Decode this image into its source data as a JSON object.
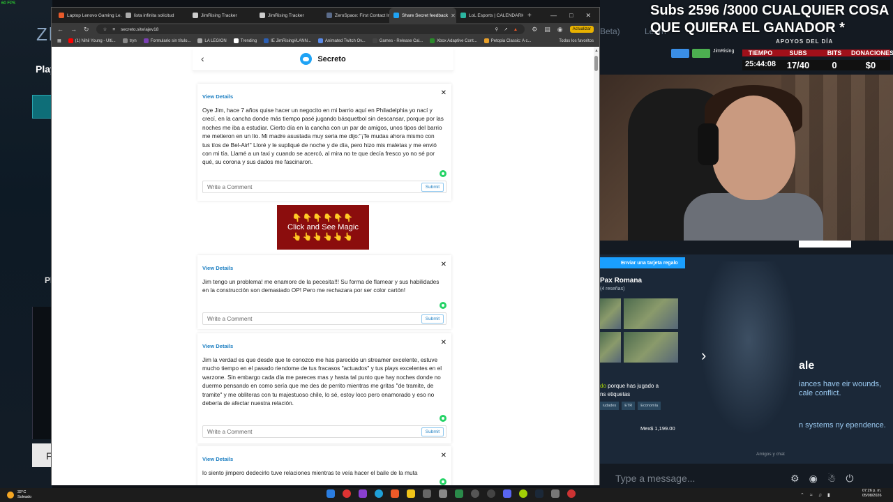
{
  "overlay": {
    "fps": "60 FPS",
    "subs_text": "Subs 2596 /3000 CUALQUIER COSA QUE QUIERA EL GANADOR *",
    "ghost_beta": "Beta)",
    "ghost_learn": "Learn",
    "apoyos": "APOYOS DEL DÍA",
    "channel_name": "JimRising",
    "stats": [
      {
        "label": "TIEMPO",
        "value": "25:44:08"
      },
      {
        "label": "SUBS",
        "value": "17/40"
      },
      {
        "label": "BITS",
        "value": "0"
      },
      {
        "label": "DONACIONES",
        "value": "$0"
      }
    ]
  },
  "background_game": {
    "logo_fragment": "Zl",
    "play_label": "Play",
    "pl_label": "Pl",
    "f_label": "F"
  },
  "browser": {
    "tabs": [
      {
        "label": "Laptop Lenovo Gaming Le...",
        "color": "#e85a2a"
      },
      {
        "label": "lista infinita solicitud",
        "color": "#aaaaaa"
      },
      {
        "label": "JimRising Tracker",
        "color": "#cccccc"
      },
      {
        "label": "JimRising Tracker",
        "color": "#cccccc"
      },
      {
        "label": "ZeroSpace: First Contact In...",
        "color": "#5a6b8a"
      },
      {
        "label": "Share Secret feedback",
        "color": "#1fa3f5",
        "active": true
      },
      {
        "label": "LoL Esports | CALENDARIO",
        "color": "#2bb5a0"
      }
    ],
    "new_tab": "+",
    "url": "secreto.site/ajev18",
    "update_button": "Actualizar",
    "bookmarks": [
      {
        "label": "(1) Nihil Young - Ulti...",
        "color": "#ff0000"
      },
      {
        "label": "tryn",
        "color": "#888888"
      },
      {
        "label": "Formulario sin título...",
        "color": "#7b3fb5"
      },
      {
        "label": "LA LEGION",
        "color": "#aaaaaa"
      },
      {
        "label": "Trending",
        "color": "#ffffff"
      },
      {
        "label": "IE JimRising#LANN...",
        "color": "#2b5fb5"
      },
      {
        "label": "Animated Twitch Ov...",
        "color": "#5a8ae8"
      },
      {
        "label": "Games - Release Cal...",
        "color": "#444444"
      },
      {
        "label": "Xbox Adaptive Cont...",
        "color": "#2a8a2a"
      },
      {
        "label": "Petopia Classic: A c...",
        "color": "#e8a02a"
      }
    ],
    "bookmarks_all": "Todos los favoritos"
  },
  "page": {
    "title": "Secreto",
    "view_details": "View Details",
    "comment_placeholder": "Write a Comment",
    "submit_label": "Submit",
    "messages": [
      "Oye Jim, hace 7 años quise hacer un negocito en mi barrio aquí en Philadelphia yo nací y crecí, en la cancha donde más tiempo pasé jugando básquetbol sin descansar, porque por las noches me iba a estudiar. Cierto día en la cancha con un par de amigos, unos tipos del barrio me metieron en un lío. Mi madre asustada muy seria me dijo:\"¡Te mudas ahora mismo con tus tíos de Bel-Air!\" Lloré y le supliqué de noche y de día, pero hizo mis maletas y me envió con mi tía. Llamé a un taxi y cuando se acercó, al mira no te que decía fresco yo no sé por qué, su corona y sus dados me fascinaron.",
      "Jim tengo un problema! me enamore de la pecesita!!! Su forma de flamear y sus habilidades en la construcción son demasiado OP! Pero me rechazara por ser color cartón!",
      "Jim la verdad es que desde que te conozco me has parecido un streamer excelente, estuve mucho tiempo en el pasado riendome de tus fracasos \"actuados\" y tus plays excelentes en el warzone. Sin embargo cada día me pareces mas y hasta tal punto que hay noches donde no duermo pensando en como sería que me des de perrito mientras me gritas \"de tramite, de tramite\" y me obliteras con tu majestuoso chile, lo sé, estoy loco pero enamorado y eso no debería de afectar nuestra relación.",
      "lo siento jimpero dedecirlo tuve relaciones mientras te veía hacer el baile de la muta"
    ],
    "ad": {
      "hands_top": "👇👇👇👇👇👇",
      "text": "Click and See Magic",
      "hands_bottom": "👆👆👆👆👆👆"
    }
  },
  "steam": {
    "gift_label": "Enviar una tarjeta regalo",
    "game_title": "Pax Romana",
    "reviews": "(4 reseñas)",
    "reason_highlight": "do",
    "reason_text": " porque has jugado a",
    "reason_line2": "ns etiquetas",
    "tags": [
      "iudades",
      "ETR",
      "Economía"
    ],
    "price": "Mex$ 1,199.00",
    "side_title": "ale",
    "side_text": "iances have eir wounds, cale conflict.",
    "side_text2": "n systems ny ependence.",
    "friends_chat": "Amigos y chat",
    "chat_placeholder": "Type a message..."
  },
  "taskbar": {
    "temp": "32°C",
    "weather": "Soleado",
    "time": "07:26 p. m.",
    "date": "05/08/2026"
  }
}
